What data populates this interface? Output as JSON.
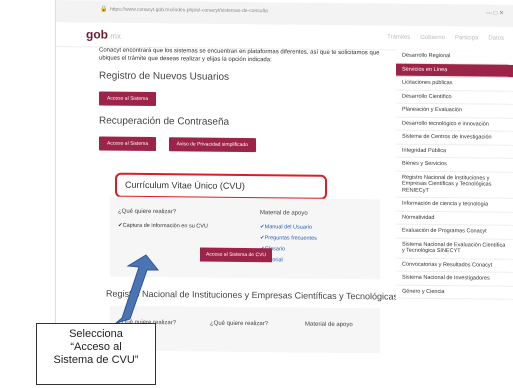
{
  "browser": {
    "url": "https://www.conacyt.gob.mx/index.php/el-conacyt/sistemas-de-consulta",
    "controls": "—  □  ✕"
  },
  "header": {
    "logo_text": "gob",
    "logo_suffix": ".mx",
    "nav": [
      "Trámites",
      "Gobierno",
      "Participa",
      "Datos"
    ]
  },
  "main": {
    "intro": "Conacyt encontrará que los sistemas se encuentran en plataformas diferentes, así que te solicitamos que ubiques el trámite que deseas realizar y elijas la opción indicada:",
    "registro_title": "Registro de Nuevos Usuarios",
    "registro_button": "Acceso al Sistema",
    "recuperacion_title": "Recuperación de Contraseña",
    "recuperacion_button": "Acceso al Sistema",
    "aviso_button": "Aviso de Privacidad simplificado",
    "cvu_title": "Currículum Vitae Único (CVU)",
    "cvu_question": "¿Qué quiere realizar?",
    "cvu_action": "✔Captura de información en su CVU",
    "cvu_button": "Acceso al Sistema de CVU",
    "material_title": "Material de apoyo",
    "material_links": [
      "✔Manual del Usuario",
      "✔Preguntas frecuentes",
      "✔Glosario",
      "✔Tutorial"
    ],
    "renie_title": "Registro Nacional de Instituciones y Empresas Científicas y Tecnológicas (RENIECyT)",
    "renie_q1": "¿Qué quiere realizar?",
    "renie_q2": "¿Qué quiere realizar?",
    "renie_material": "Material de apoyo"
  },
  "sidebar": {
    "items": [
      "Desarrollo Regional",
      "Servicios en Línea",
      "Licitaciones públicas",
      "Desarrollo Científico",
      "Planeación y Evaluación",
      "Desarrollo tecnológico e innovación",
      "Sistema de Centros de Investigación",
      "Integridad Pública",
      "Bienes y Servicios",
      "Registro Nacional de Instituciones y Empresas Científicas y Tecnológicas RENIECyT",
      "Información de ciencia y tecnología",
      "Normatividad",
      "Evaluación de Programas Conacyt",
      "Sistema Nacional de Evaluación Científica y Tecnológica SINECYT",
      "Convocatorias y Resultados Conacyt",
      "Sistema Nacional de Investigadores",
      "Género y Ciencia"
    ],
    "active_index": 1
  },
  "callout": {
    "line1": "Selecciona",
    "line2": "“Acceso al",
    "line3": "Sistema de CVU”"
  },
  "colors": {
    "brand": "#9d2449",
    "highlight": "#d72023",
    "arrow": "#4a74b4"
  }
}
